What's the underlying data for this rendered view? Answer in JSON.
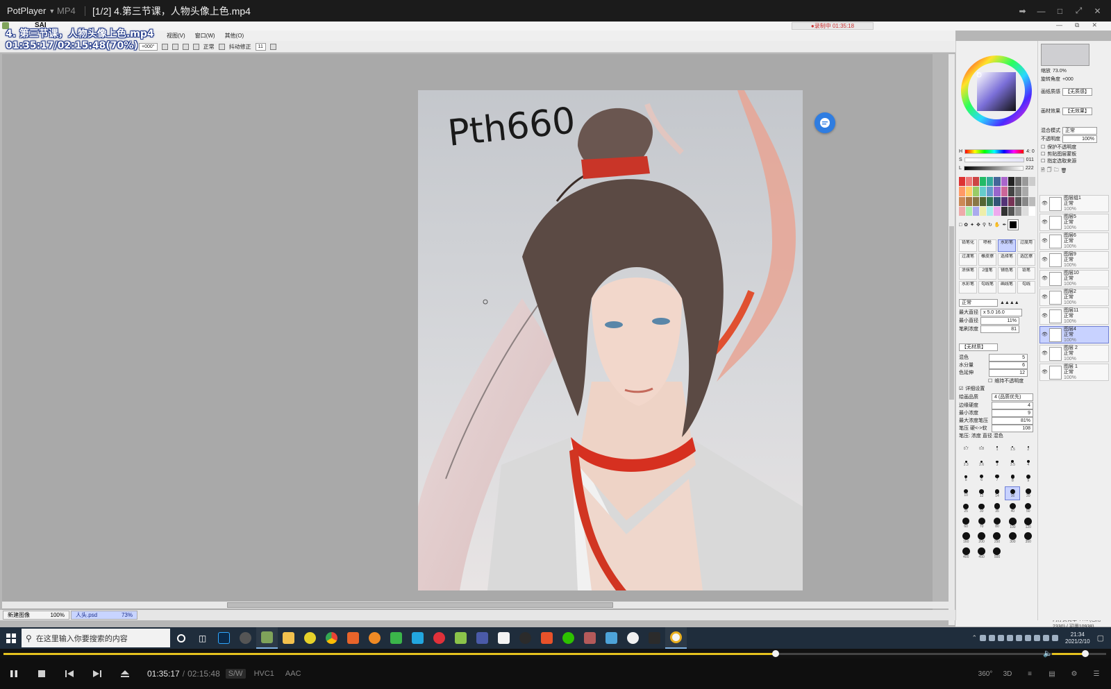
{
  "player": {
    "brand": "PotPlayer",
    "format": "MP4",
    "file_title": "[1/2] 4.第三节课，人物头像上色.mp4"
  },
  "osd": {
    "line1": "4. 第三节课，人物头像上色.mp4",
    "line2": "01:35:17/02:15:48(70%)"
  },
  "sai": {
    "app_title": "SAI",
    "recording": "●录制中 01:35:18",
    "menu": [
      "视图(V)",
      "窗口(W)",
      "其他(O)"
    ],
    "toolbar": {
      "angle": "+000°",
      "blend": "正常",
      "stabilizer_label": "抖动修正",
      "stabilizer_value": "11"
    },
    "artwork_signature": "Pth660",
    "doc_tabs": [
      {
        "name": "新建图像",
        "zoom": "100%"
      },
      {
        "name": "人头.psd",
        "zoom": "73%"
      }
    ],
    "status": "内存负荷率 44% (已用2330) / 可用10938)",
    "tool_panel": {
      "hsv_h": "4: 0",
      "hsv_s": "011",
      "hsv_v": "222",
      "blend_mode": "正常",
      "brushes": [
        "铅笔化",
        "喷枪",
        "水彩笔",
        "过度用",
        "过渡笔",
        "橡皮擦",
        "选择笔",
        "选区擦",
        "涂抹笔",
        "2值笔",
        "铺色笔",
        "铅笔",
        "水彩笔",
        "勾线笔",
        "画线笔",
        "勾线"
      ],
      "max_diameter_label": "最大直径",
      "max_diameter": "x 5.0   16.0",
      "min_diameter_label": "最小直径",
      "min_diameter": "11%",
      "density_label": "笔刷浓度",
      "density": "81",
      "texture_label": "【无材质】",
      "mix_label": "混色",
      "mix": "5",
      "water_label": "水分量",
      "water": "6",
      "stretch_label": "色延伸",
      "stretch": "12",
      "keep_opacity": "维持不透明度",
      "detail_label": "详细设置",
      "quality_label": "绘画品质",
      "quality": "4 (品质优先)",
      "edge_label": "边缘硬度",
      "edge": "4",
      "min_density_label": "最小浓度",
      "min_density": "9",
      "max_pressure_label": "最大浓度笔压",
      "max_pressure": "81%",
      "pressure_label": "笔压 硬<->软",
      "pressure": "108",
      "pressure_opts": "笔压: 浓度  直径  混色",
      "sizes": [
        "0.7",
        "0.8",
        "1",
        "1.5",
        "2",
        "2.3",
        "2.6",
        "3",
        "3.5",
        "4",
        "5",
        "6",
        "7",
        "8",
        "9",
        "10",
        "12",
        "14",
        "16",
        "20",
        "25",
        "30",
        "35",
        "40",
        "50",
        "60",
        "70",
        "80",
        "100",
        "120",
        "160",
        "200",
        "250",
        "300",
        "350",
        "400",
        "450",
        "500"
      ]
    },
    "layer_panel": {
      "zoom_label": "缩放",
      "zoom": "73.0%",
      "rotate_label": "旋转角度",
      "rotate": "+000",
      "paper_label": "画纸质感",
      "paper": "【无质感】",
      "effect_label": "画材效果",
      "effect": "【无效果】",
      "blend_label": "混合模式",
      "blend": "正常",
      "opacity_label": "不透明度",
      "opacity": "100%",
      "opts": [
        "保护不透明度",
        "剪贴图层蒙板",
        "指定选取来源"
      ],
      "layers": [
        {
          "name": "图层组1",
          "mode": "正常",
          "op": "100%",
          "type": "folder"
        },
        {
          "name": "图层5",
          "mode": "正常",
          "op": "100%"
        },
        {
          "name": "图层6",
          "mode": "正常",
          "op": "100%"
        },
        {
          "name": "图层9",
          "mode": "正常",
          "op": "100%"
        },
        {
          "name": "图层10",
          "mode": "正常",
          "op": "100%"
        },
        {
          "name": "图层2",
          "mode": "正常",
          "op": "100%"
        },
        {
          "name": "图层11",
          "mode": "正常",
          "op": "100%"
        },
        {
          "name": "图层4",
          "mode": "正常",
          "op": "100%",
          "selected": true
        },
        {
          "name": "图层 2",
          "mode": "正常",
          "op": "100%"
        },
        {
          "name": "图层 1",
          "mode": "正常",
          "op": "100%"
        }
      ]
    }
  },
  "taskbar": {
    "search_placeholder": "在这里输入你要搜索的内容",
    "clock_time": "21:34",
    "clock_date": "2021/2/10"
  },
  "controls": {
    "current": "01:35:17",
    "separator": "/",
    "total": "02:15:48",
    "tags": [
      "S/W",
      "HVC1",
      "AAC"
    ],
    "progress": 0.7,
    "volume": 0.72,
    "right": [
      "360°",
      "3D",
      "≡",
      "▤",
      "⚙",
      "☰"
    ]
  },
  "colors": {
    "accent_progress": "#e6c21f",
    "float_button": "#2f7de1",
    "sel_layer": "#c8d2ff"
  }
}
